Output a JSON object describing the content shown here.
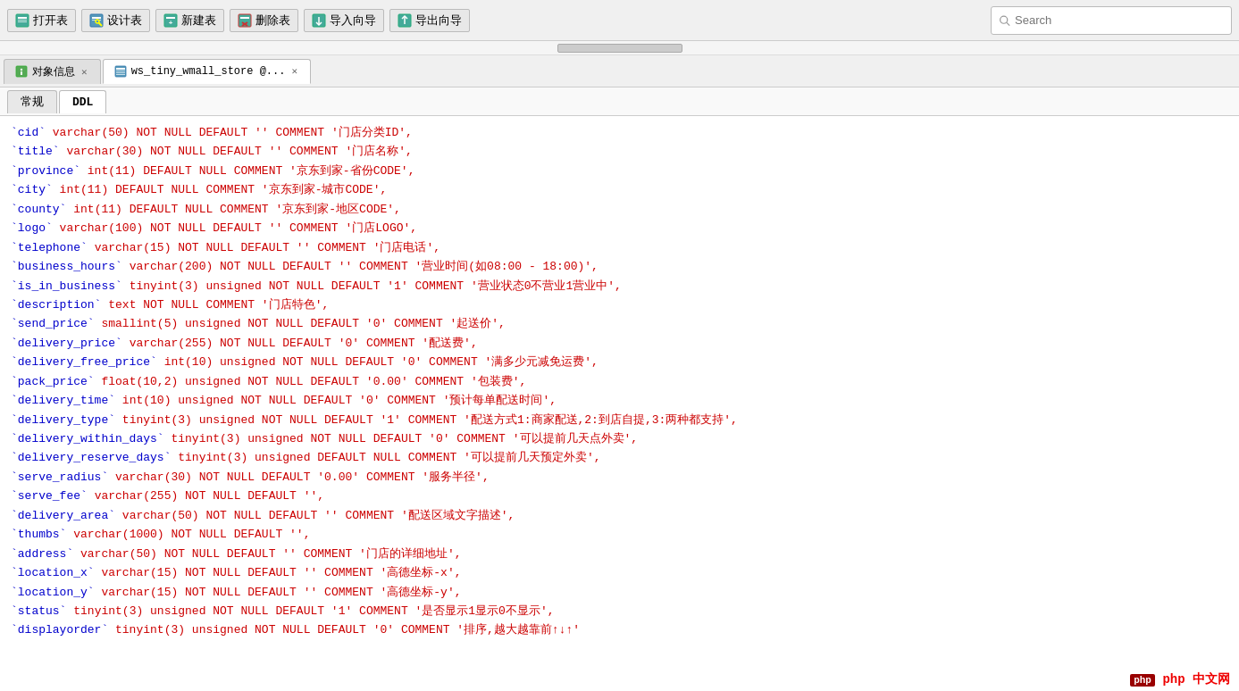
{
  "toolbar": {
    "buttons": [
      {
        "label": "打开表",
        "icon": "table-open"
      },
      {
        "label": "设计表",
        "icon": "table-design"
      },
      {
        "label": "新建表",
        "icon": "table-new"
      },
      {
        "label": "删除表",
        "icon": "table-delete"
      },
      {
        "label": "导入向导",
        "icon": "import"
      },
      {
        "label": "导出向导",
        "icon": "export"
      }
    ],
    "search_placeholder": "Search"
  },
  "tabs": [
    {
      "label": "对象信息",
      "icon": "info",
      "active": false,
      "closable": true
    },
    {
      "label": "ws_tiny_wmall_store @...",
      "icon": "table",
      "active": true,
      "closable": true
    }
  ],
  "sub_tabs": [
    {
      "label": "常规",
      "active": false
    },
    {
      "label": "DDL",
      "active": true
    }
  ],
  "ddl_lines": [
    "`cid` varchar(50) NOT NULL DEFAULT '' COMMENT '门店分类ID',",
    "`title` varchar(30) NOT NULL DEFAULT '' COMMENT '门店名称',",
    "`province` int(11) DEFAULT NULL COMMENT '京东到家-省份CODE',",
    "`city` int(11) DEFAULT NULL COMMENT '京东到家-城市CODE',",
    "`county` int(11) DEFAULT NULL COMMENT '京东到家-地区CODE',",
    "`logo` varchar(100) NOT NULL DEFAULT '' COMMENT '门店LOGO',",
    "`telephone` varchar(15) NOT NULL DEFAULT '' COMMENT '门店电话',",
    "`business_hours` varchar(200) NOT NULL DEFAULT '' COMMENT '营业时间(如08:00 - 18:00)',",
    "`is_in_business` tinyint(3) unsigned NOT NULL DEFAULT '1' COMMENT '营业状态0不营业1营业中',",
    "`description` text NOT NULL COMMENT '门店特色',",
    "`send_price` smallint(5) unsigned NOT NULL DEFAULT '0' COMMENT '起送价',",
    "`delivery_price` varchar(255) NOT NULL DEFAULT '0' COMMENT '配送费',",
    "`delivery_free_price` int(10) unsigned NOT NULL DEFAULT '0' COMMENT '满多少元减免运费',",
    "`pack_price` float(10,2) unsigned NOT NULL DEFAULT '0.00' COMMENT '包装费',",
    "`delivery_time` int(10) unsigned NOT NULL DEFAULT '0' COMMENT '预计每单配送时间',",
    "`delivery_type` tinyint(3) unsigned NOT NULL DEFAULT '1' COMMENT '配送方式1:商家配送,2:到店自提,3:两种都支持',",
    "`delivery_within_days` tinyint(3) unsigned NOT NULL DEFAULT '0' COMMENT '可以提前几天点外卖',",
    "`delivery_reserve_days` tinyint(3) unsigned DEFAULT NULL COMMENT '可以提前几天预定外卖',",
    "`serve_radius` varchar(30) NOT NULL DEFAULT '0.00' COMMENT '服务半径',",
    "`serve_fee` varchar(255) NOT NULL DEFAULT '',",
    "`delivery_area` varchar(50) NOT NULL DEFAULT '' COMMENT '配送区域文字描述',",
    "`thumbs` varchar(1000) NOT NULL DEFAULT '',",
    "`address` varchar(50) NOT NULL DEFAULT '' COMMENT '门店的详细地址',",
    "`location_x` varchar(15) NOT NULL DEFAULT '' COMMENT '高德坐标-x',",
    "`location_y` varchar(15) NOT NULL DEFAULT '' COMMENT '高德坐标-y',",
    "`status` tinyint(3) unsigned NOT NULL DEFAULT '1' COMMENT '是否显示1显示0不显示',",
    "`displayorder` tinyint(3) unsigned NOT NULL DEFAULT '0' COMMENT '排序,越大越靠前↑↓↑'"
  ],
  "footer": {
    "brand": "php 中文网"
  }
}
